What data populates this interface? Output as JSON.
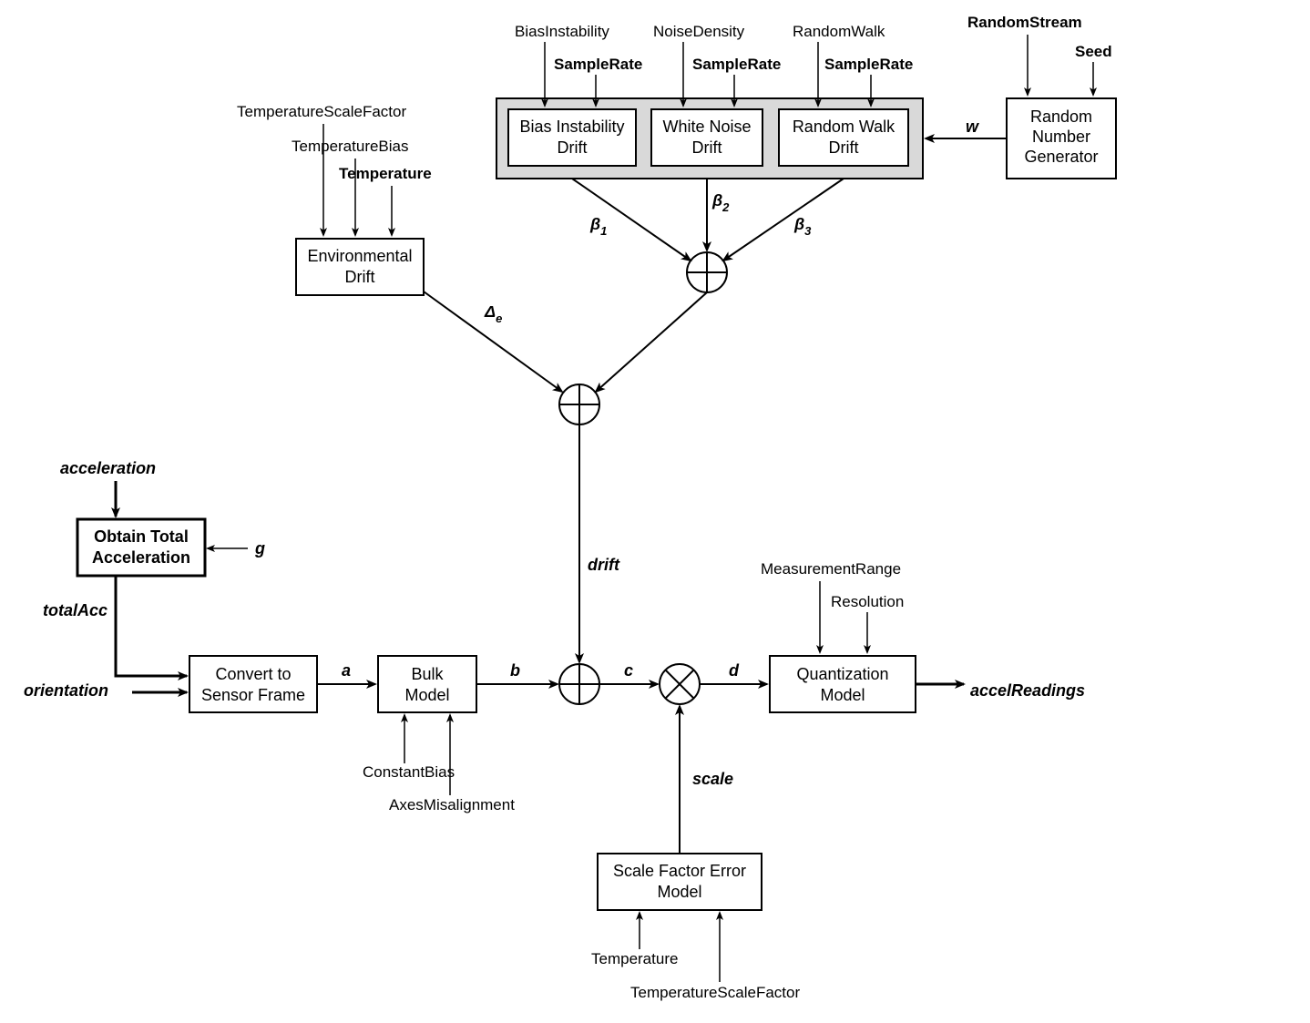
{
  "inputs": {
    "acceleration": "acceleration",
    "orientation": "orientation",
    "g": "g",
    "totalAcc": "totalAcc",
    "a": "a",
    "b": "b",
    "c": "c",
    "d": "d",
    "drift": "drift",
    "scale": "scale",
    "w": "w",
    "delta_e": "Δ",
    "delta_e_sub": "e",
    "beta1": "β",
    "beta1_sub": "1",
    "beta2": "β",
    "beta2_sub": "2",
    "beta3": "β",
    "beta3_sub": "3"
  },
  "boxes": {
    "obtainTotal": {
      "l1": "Obtain Total",
      "l2": "Acceleration"
    },
    "convert": {
      "l1": "Convert to",
      "l2": "Sensor Frame"
    },
    "bulk": {
      "l1": "Bulk",
      "l2": "Model"
    },
    "quant": {
      "l1": "Quantization",
      "l2": "Model"
    },
    "scaleErr": {
      "l1": "Scale Factor Error",
      "l2": "Model"
    },
    "envDrift": {
      "l1": "Environmental",
      "l2": "Drift"
    },
    "biasDrift": {
      "l1": "Bias Instability",
      "l2": "Drift"
    },
    "whiteDrift": {
      "l1": "White Noise",
      "l2": "Drift"
    },
    "randomDrift": {
      "l1": "Random Walk",
      "l2": "Drift"
    },
    "rng": {
      "l1": "Random",
      "l2": "Number",
      "l3": "Generator"
    }
  },
  "params": {
    "tempScaleFactor": "TemperatureScaleFactor",
    "tempBias": "TemperatureBias",
    "temperature": "Temperature",
    "biasInstability": "BiasInstability",
    "sampleRate": "SampleRate",
    "noiseDensity": "NoiseDensity",
    "randomWalk": "RandomWalk",
    "randomStream": "RandomStream",
    "seed": "Seed",
    "constantBias": "ConstantBias",
    "axesMis": "AxesMisalignment",
    "measRange": "MeasurementRange",
    "resolution": "Resolution",
    "temperature2": "Temperature",
    "tempScaleFactor2": "TemperatureScaleFactor"
  },
  "output": {
    "accelReadings": "accelReadings"
  }
}
